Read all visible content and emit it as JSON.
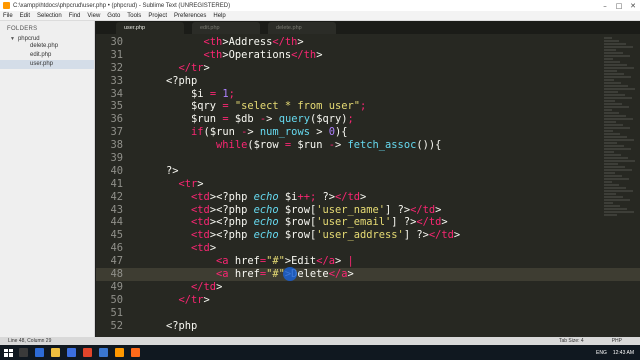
{
  "window": {
    "title": "C:\\xampp\\htdocs\\phpcrud\\user.php • (phpcrud) - Sublime Text (UNREGISTERED)",
    "controls": [
      "–",
      "□",
      "✕"
    ]
  },
  "menu": [
    "File",
    "Edit",
    "Selection",
    "Find",
    "View",
    "Goto",
    "Tools",
    "Project",
    "Preferences",
    "Help"
  ],
  "sidebar": {
    "header": "FOLDERS",
    "folder": "phpcrud",
    "files": [
      {
        "name": "delete.php",
        "active": false
      },
      {
        "name": "edit.php",
        "active": false
      },
      {
        "name": "user.php",
        "active": true
      }
    ]
  },
  "tabs": [
    {
      "label": "user.php",
      "active": true
    },
    {
      "label": "edit.php",
      "active": false
    },
    {
      "label": "delete.php",
      "active": false
    }
  ],
  "code_lines": [
    {
      "n": 30,
      "text": "<th>Address</th>"
    },
    {
      "n": 31,
      "text": "<th>Operations</th>"
    },
    {
      "n": 32,
      "text": "</tr>"
    },
    {
      "n": 33,
      "text": "<?php"
    },
    {
      "n": 34,
      "text": "$i = 1;"
    },
    {
      "n": 35,
      "text": "$qry = \"select * from user\";"
    },
    {
      "n": 36,
      "text": "$run = $db -> query($qry);"
    },
    {
      "n": 37,
      "text": "if($run -> num_rows > 0){"
    },
    {
      "n": 38,
      "text": "while($row = $run -> fetch_assoc()){"
    },
    {
      "n": 39,
      "text": ""
    },
    {
      "n": 40,
      "text": "?>"
    },
    {
      "n": 41,
      "text": "<tr>"
    },
    {
      "n": 42,
      "text": "<td><?php echo $i++; ?></td>"
    },
    {
      "n": 43,
      "text": "<td><?php echo $row['user_name'] ?></td>"
    },
    {
      "n": 44,
      "text": "<td><?php echo $row['user_email'] ?></td>"
    },
    {
      "n": 45,
      "text": "<td><?php echo $row['user_address'] ?></td>"
    },
    {
      "n": 46,
      "text": "<td>"
    },
    {
      "n": 47,
      "text": "<a href=\"#\">Edit</a> |"
    },
    {
      "n": 48,
      "text": "<a href=\"#\">Delete</a>"
    },
    {
      "n": 49,
      "text": "</td>"
    },
    {
      "n": 50,
      "text": "</tr>"
    },
    {
      "n": 51,
      "text": ""
    },
    {
      "n": 52,
      "text": "<?php"
    }
  ],
  "status": {
    "position": "Line 48, Column 29",
    "tab_size": "Tab Size: 4",
    "syntax": "PHP"
  },
  "taskbar": {
    "lang": "ENG",
    "time": "12:43 AM"
  },
  "colors": {
    "editor_bg": "#272822",
    "tag": "#f92672",
    "string": "#e6db74",
    "function": "#66d9ef",
    "number": "#ae81ff"
  }
}
